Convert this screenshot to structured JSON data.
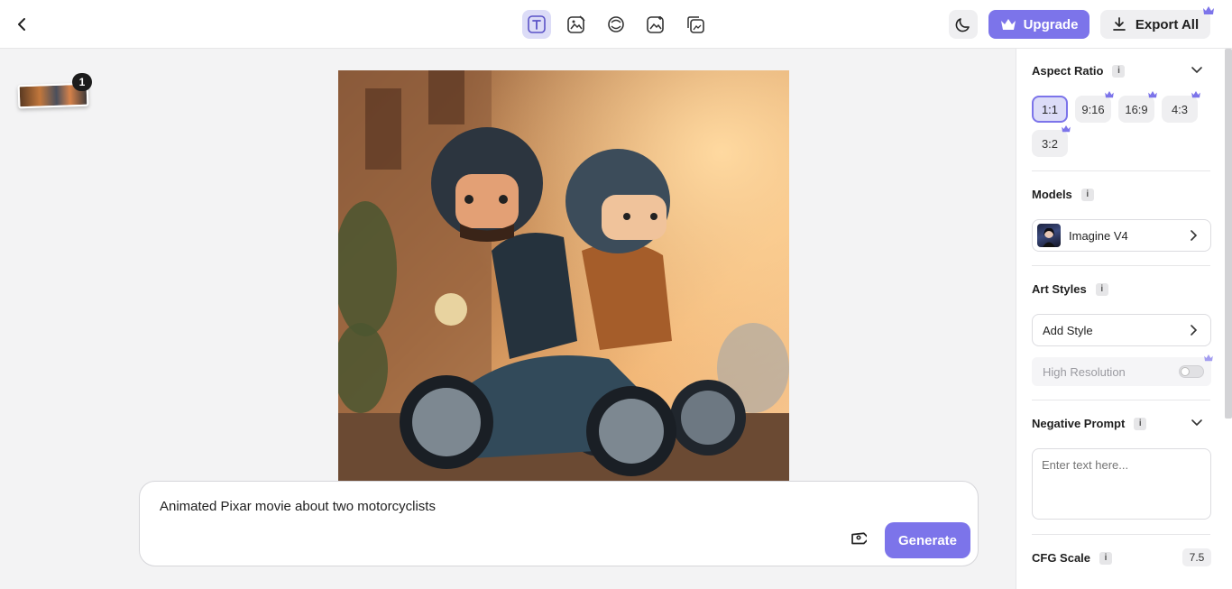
{
  "header": {
    "upgrade_label": "Upgrade",
    "export_label": "Export All"
  },
  "toolbar": {
    "tools": [
      "text-to-image",
      "image-edit",
      "remix",
      "image-to-image",
      "gallery"
    ]
  },
  "thumbnail": {
    "count": "1"
  },
  "prompt": {
    "text": "Animated Pixar movie about two motorcyclists",
    "generate_label": "Generate"
  },
  "panel": {
    "aspect_ratio": {
      "label": "Aspect Ratio",
      "options": [
        "1:1",
        "9:16",
        "16:9",
        "4:3",
        "3:2"
      ],
      "selected": "1:1"
    },
    "models": {
      "label": "Models",
      "selected": "Imagine V4"
    },
    "art_styles": {
      "label": "Art Styles",
      "add_label": "Add Style"
    },
    "high_resolution": {
      "label": "High Resolution",
      "enabled": false
    },
    "negative_prompt": {
      "label": "Negative Prompt",
      "placeholder": "Enter text here..."
    },
    "cfg_scale": {
      "label": "CFG Scale",
      "value": "7.5"
    },
    "info_glyph": "i"
  },
  "colors": {
    "accent": "#7c74ea",
    "accent_light": "#dcdcf7",
    "panel_bg": "#ffffff",
    "canvas_bg": "#f3f3f4"
  }
}
